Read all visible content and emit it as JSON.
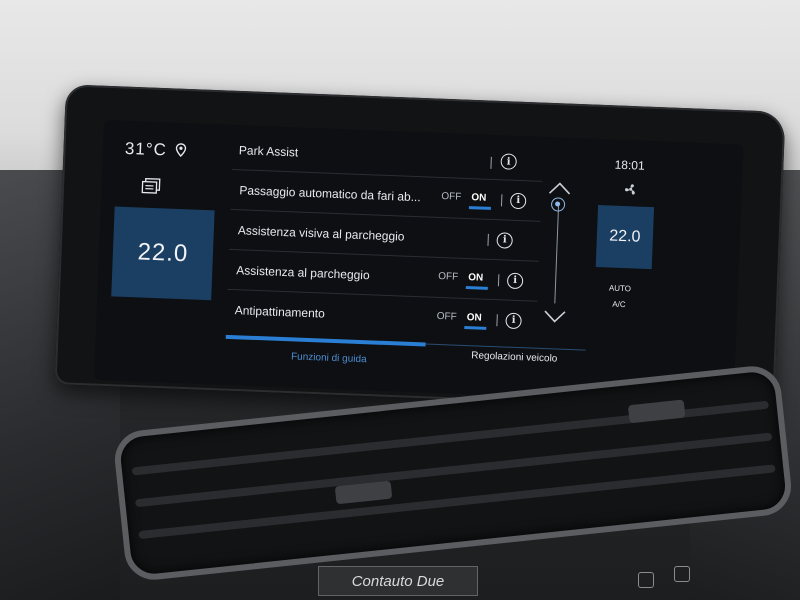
{
  "status": {
    "outside_temp": "31°C",
    "clock": "18:01"
  },
  "climate": {
    "left_temp": "22.0",
    "right_temp": "22.0",
    "auto_label": "AUTO",
    "ac_label": "A/C"
  },
  "list": {
    "header": "Park Assist",
    "items": [
      {
        "label": "Passaggio automatico da fari ab...",
        "has_toggle": true,
        "off": "OFF",
        "on": "ON",
        "state": "on"
      },
      {
        "label": "Assistenza visiva al parcheggio",
        "has_toggle": false
      },
      {
        "label": "Assistenza al parcheggio",
        "has_toggle": true,
        "off": "OFF",
        "on": "ON",
        "state": "on"
      },
      {
        "label": "Antipattinamento",
        "has_toggle": true,
        "off": "OFF",
        "on": "ON",
        "state": "on"
      }
    ]
  },
  "tabs": {
    "left": "Funzioni di guida",
    "right": "Regolazioni veicolo"
  },
  "info_glyph": "i",
  "watermark": "Contauto Due",
  "colors": {
    "accent": "#2a7fd4",
    "tile": "#1b3f63",
    "screen_bg": "#0d0f12"
  },
  "icons": [
    "location-pin-icon",
    "menu-icon",
    "info-icon",
    "chevron-up-icon",
    "chevron-down-icon",
    "fan-icon"
  ]
}
